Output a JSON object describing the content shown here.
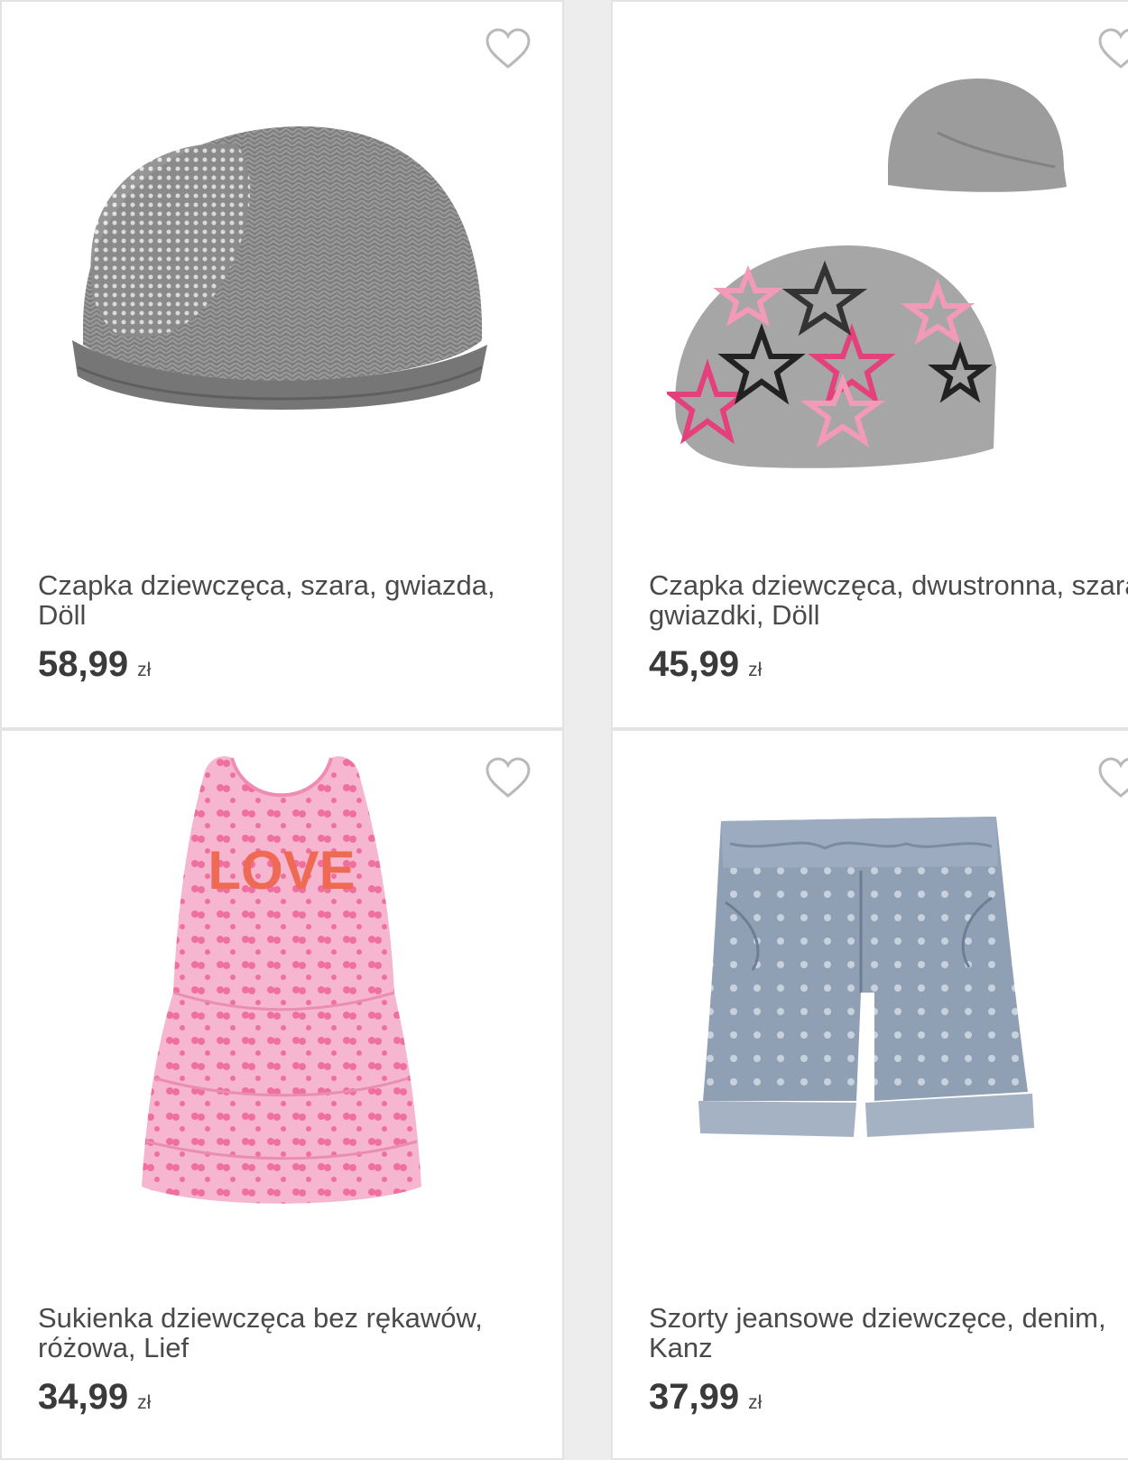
{
  "products": [
    {
      "title": "Czapka dziewczęca, szara, gwiazda, Döll",
      "price": "58,99",
      "currency": "zł",
      "image_icon": "knit-beanie-image",
      "favorite_icon": "heart-outline-icon"
    },
    {
      "title": "Czapka dziewczęca, dwustronna, szara, gwiazdki, Döll",
      "price": "45,99",
      "currency": "zł",
      "image_icon": "star-beanie-image",
      "favorite_icon": "heart-outline-icon"
    },
    {
      "title": "Sukienka dziewczęca bez rękawów, różowa, Lief",
      "price": "34,99",
      "currency": "zł",
      "image_icon": "pink-dress-image",
      "favorite_icon": "heart-outline-icon"
    },
    {
      "title": "Szorty jeansowe dziewczęce, denim, Kanz",
      "price": "37,99",
      "currency": "zł",
      "image_icon": "denim-shorts-image",
      "favorite_icon": "heart-outline-icon"
    }
  ],
  "dress_print": "LOVE",
  "colors": {
    "background": "#ededed",
    "card": "#ffffff",
    "text": "#4a4a4a",
    "heart": "#b9b9b9"
  }
}
